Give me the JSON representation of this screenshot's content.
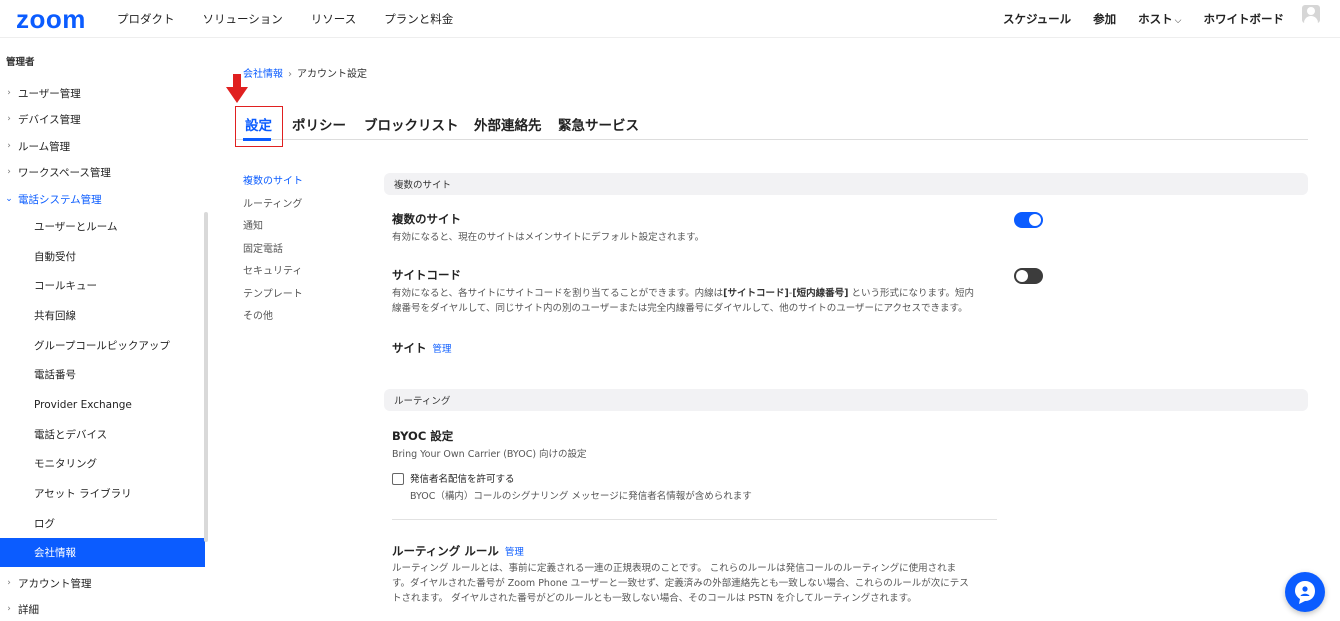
{
  "brand": {
    "logo": "zoom",
    "accent": "#0b5cff"
  },
  "topnav": {
    "left": [
      "プロダクト",
      "ソリューション",
      "リソース",
      "プランと料金"
    ],
    "right": {
      "schedule": "スケジュール",
      "join": "参加",
      "host": "ホスト",
      "whiteboard": "ホワイトボード"
    }
  },
  "sidebar": {
    "header": "管理者",
    "top_items": [
      "ユーザー管理",
      "デバイス管理",
      "ルーム管理",
      "ワークスペース管理"
    ],
    "open_item": "電話システム管理",
    "sub_items": [
      "ユーザーとルーム",
      "自動受付",
      "コールキュー",
      "共有回線",
      "グループコールピックアップ",
      "電話番号",
      "Provider Exchange",
      "電話とデバイス",
      "モニタリング",
      "アセット ライブラリ",
      "ログ",
      "会社情報"
    ],
    "active_sub": "会社情報",
    "bottom_items": [
      "アカウント管理",
      "詳細"
    ]
  },
  "breadcrumb": {
    "parent": "会社情報",
    "current": "アカウント設定"
  },
  "tabs": [
    "設定",
    "ポリシー",
    "ブロックリスト",
    "外部連絡先",
    "緊急サービス"
  ],
  "active_tab": "設定",
  "subnav": [
    "複数のサイト",
    "ルーティング",
    "通知",
    "固定電話",
    "セキュリティ",
    "テンプレート",
    "その他"
  ],
  "sections": {
    "sites": {
      "header": "複数のサイト",
      "multi_site": {
        "title": "複数のサイト",
        "desc": "有効になると、現在のサイトはメインサイトにデフォルト設定されます。",
        "enabled": true
      },
      "site_code": {
        "title": "サイトコード",
        "desc_1": "有効になると、各サイトにサイトコードを割り当てることができます。内線は",
        "desc_code": "[サイトコード]",
        "desc_dash": "-",
        "desc_ext": "[短内線番号]",
        "desc_2": " という形式になります。短内",
        "desc_3": "線番号をダイヤルして、同じサイト内の別のユーザーまたは完全内線番号にダイヤルして、他のサイトのユーザーにアクセスできます。",
        "enabled": false
      },
      "site_link": {
        "title": "サイト",
        "manage": "管理"
      }
    },
    "routing": {
      "header": "ルーティング",
      "byoc": {
        "title": "BYOC 設定",
        "desc": "Bring Your Own Carrier (BYOC) 向けの設定"
      },
      "caller_id": {
        "label": "発信者名配信を許可する",
        "desc": "BYOC（構内）コールのシグナリング メッセージに発信者名情報が含められます",
        "checked": false
      },
      "rules": {
        "title": "ルーティング ルール",
        "manage": "管理",
        "desc_1": "ルーティング ルールとは、事前に定義される一連の正規表現のことです。 これらのルールは発信コールのルーティングに使用されま",
        "desc_2": "す。ダイヤルされた番号が Zoom Phone ユーザーと一致せず、定義済みの外部連絡先とも一致しない場合、これらのルールが次にテス",
        "desc_3": "トされます。 ダイヤルされた番号がどのルールとも一致しない場合、そのコールは PSTN を介してルーティングされます。"
      }
    }
  }
}
